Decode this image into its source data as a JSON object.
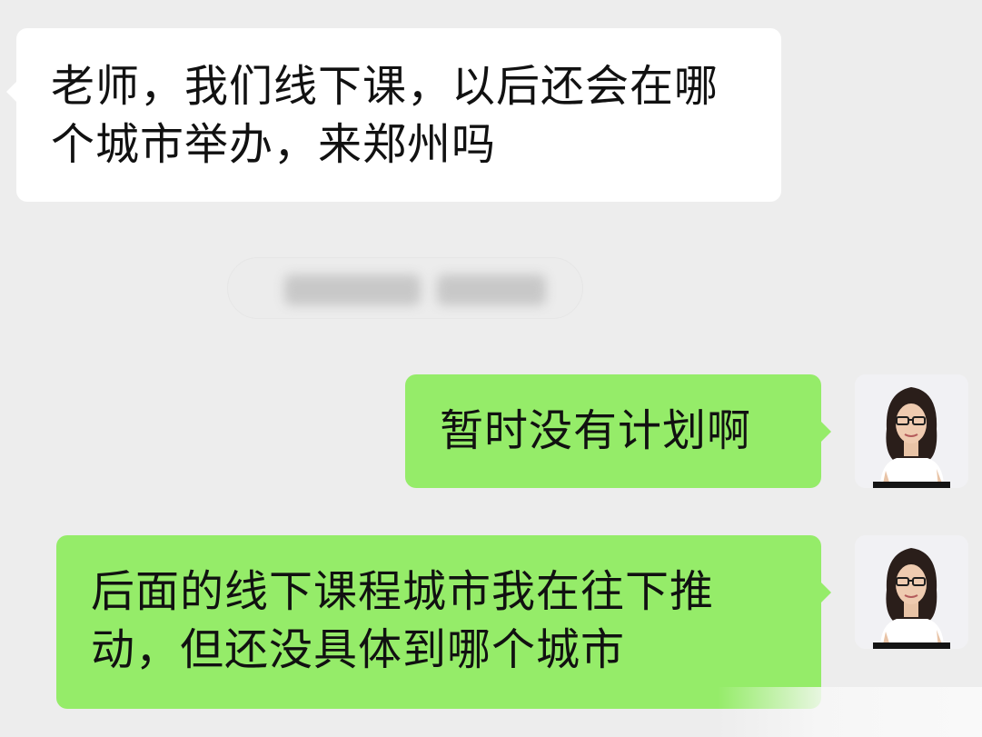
{
  "messages": [
    {
      "direction": "incoming",
      "text": "老师，我们线下课，以后还会在哪个城市举办，来郑州吗"
    },
    {
      "direction": "outgoing",
      "text": "暂时没有计划啊"
    },
    {
      "direction": "outgoing",
      "text": "后面的线下课程城市我在往下推动，但还没具体到哪个城市"
    }
  ],
  "colors": {
    "background": "#ededed",
    "incoming_bubble": "#ffffff",
    "outgoing_bubble": "#95ec69",
    "text": "#111111"
  },
  "icons": {
    "sender_avatar": "teacher-avatar-icon"
  }
}
